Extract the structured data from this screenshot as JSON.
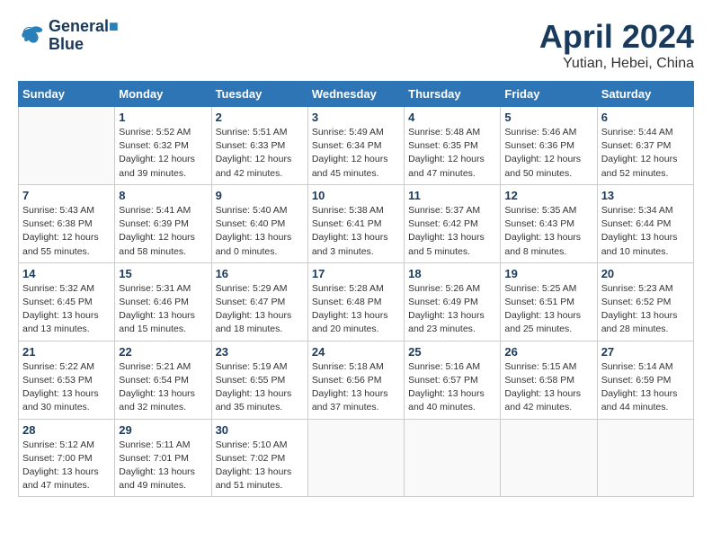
{
  "header": {
    "logo_line1": "General",
    "logo_line2": "Blue",
    "month": "April 2024",
    "location": "Yutian, Hebei, China"
  },
  "days_of_week": [
    "Sunday",
    "Monday",
    "Tuesday",
    "Wednesday",
    "Thursday",
    "Friday",
    "Saturday"
  ],
  "weeks": [
    [
      {
        "day": "",
        "info": ""
      },
      {
        "day": "1",
        "info": "Sunrise: 5:52 AM\nSunset: 6:32 PM\nDaylight: 12 hours\nand 39 minutes."
      },
      {
        "day": "2",
        "info": "Sunrise: 5:51 AM\nSunset: 6:33 PM\nDaylight: 12 hours\nand 42 minutes."
      },
      {
        "day": "3",
        "info": "Sunrise: 5:49 AM\nSunset: 6:34 PM\nDaylight: 12 hours\nand 45 minutes."
      },
      {
        "day": "4",
        "info": "Sunrise: 5:48 AM\nSunset: 6:35 PM\nDaylight: 12 hours\nand 47 minutes."
      },
      {
        "day": "5",
        "info": "Sunrise: 5:46 AM\nSunset: 6:36 PM\nDaylight: 12 hours\nand 50 minutes."
      },
      {
        "day": "6",
        "info": "Sunrise: 5:44 AM\nSunset: 6:37 PM\nDaylight: 12 hours\nand 52 minutes."
      }
    ],
    [
      {
        "day": "7",
        "info": "Sunrise: 5:43 AM\nSunset: 6:38 PM\nDaylight: 12 hours\nand 55 minutes."
      },
      {
        "day": "8",
        "info": "Sunrise: 5:41 AM\nSunset: 6:39 PM\nDaylight: 12 hours\nand 58 minutes."
      },
      {
        "day": "9",
        "info": "Sunrise: 5:40 AM\nSunset: 6:40 PM\nDaylight: 13 hours\nand 0 minutes."
      },
      {
        "day": "10",
        "info": "Sunrise: 5:38 AM\nSunset: 6:41 PM\nDaylight: 13 hours\nand 3 minutes."
      },
      {
        "day": "11",
        "info": "Sunrise: 5:37 AM\nSunset: 6:42 PM\nDaylight: 13 hours\nand 5 minutes."
      },
      {
        "day": "12",
        "info": "Sunrise: 5:35 AM\nSunset: 6:43 PM\nDaylight: 13 hours\nand 8 minutes."
      },
      {
        "day": "13",
        "info": "Sunrise: 5:34 AM\nSunset: 6:44 PM\nDaylight: 13 hours\nand 10 minutes."
      }
    ],
    [
      {
        "day": "14",
        "info": "Sunrise: 5:32 AM\nSunset: 6:45 PM\nDaylight: 13 hours\nand 13 minutes."
      },
      {
        "day": "15",
        "info": "Sunrise: 5:31 AM\nSunset: 6:46 PM\nDaylight: 13 hours\nand 15 minutes."
      },
      {
        "day": "16",
        "info": "Sunrise: 5:29 AM\nSunset: 6:47 PM\nDaylight: 13 hours\nand 18 minutes."
      },
      {
        "day": "17",
        "info": "Sunrise: 5:28 AM\nSunset: 6:48 PM\nDaylight: 13 hours\nand 20 minutes."
      },
      {
        "day": "18",
        "info": "Sunrise: 5:26 AM\nSunset: 6:49 PM\nDaylight: 13 hours\nand 23 minutes."
      },
      {
        "day": "19",
        "info": "Sunrise: 5:25 AM\nSunset: 6:51 PM\nDaylight: 13 hours\nand 25 minutes."
      },
      {
        "day": "20",
        "info": "Sunrise: 5:23 AM\nSunset: 6:52 PM\nDaylight: 13 hours\nand 28 minutes."
      }
    ],
    [
      {
        "day": "21",
        "info": "Sunrise: 5:22 AM\nSunset: 6:53 PM\nDaylight: 13 hours\nand 30 minutes."
      },
      {
        "day": "22",
        "info": "Sunrise: 5:21 AM\nSunset: 6:54 PM\nDaylight: 13 hours\nand 32 minutes."
      },
      {
        "day": "23",
        "info": "Sunrise: 5:19 AM\nSunset: 6:55 PM\nDaylight: 13 hours\nand 35 minutes."
      },
      {
        "day": "24",
        "info": "Sunrise: 5:18 AM\nSunset: 6:56 PM\nDaylight: 13 hours\nand 37 minutes."
      },
      {
        "day": "25",
        "info": "Sunrise: 5:16 AM\nSunset: 6:57 PM\nDaylight: 13 hours\nand 40 minutes."
      },
      {
        "day": "26",
        "info": "Sunrise: 5:15 AM\nSunset: 6:58 PM\nDaylight: 13 hours\nand 42 minutes."
      },
      {
        "day": "27",
        "info": "Sunrise: 5:14 AM\nSunset: 6:59 PM\nDaylight: 13 hours\nand 44 minutes."
      }
    ],
    [
      {
        "day": "28",
        "info": "Sunrise: 5:12 AM\nSunset: 7:00 PM\nDaylight: 13 hours\nand 47 minutes."
      },
      {
        "day": "29",
        "info": "Sunrise: 5:11 AM\nSunset: 7:01 PM\nDaylight: 13 hours\nand 49 minutes."
      },
      {
        "day": "30",
        "info": "Sunrise: 5:10 AM\nSunset: 7:02 PM\nDaylight: 13 hours\nand 51 minutes."
      },
      {
        "day": "",
        "info": ""
      },
      {
        "day": "",
        "info": ""
      },
      {
        "day": "",
        "info": ""
      },
      {
        "day": "",
        "info": ""
      }
    ]
  ]
}
